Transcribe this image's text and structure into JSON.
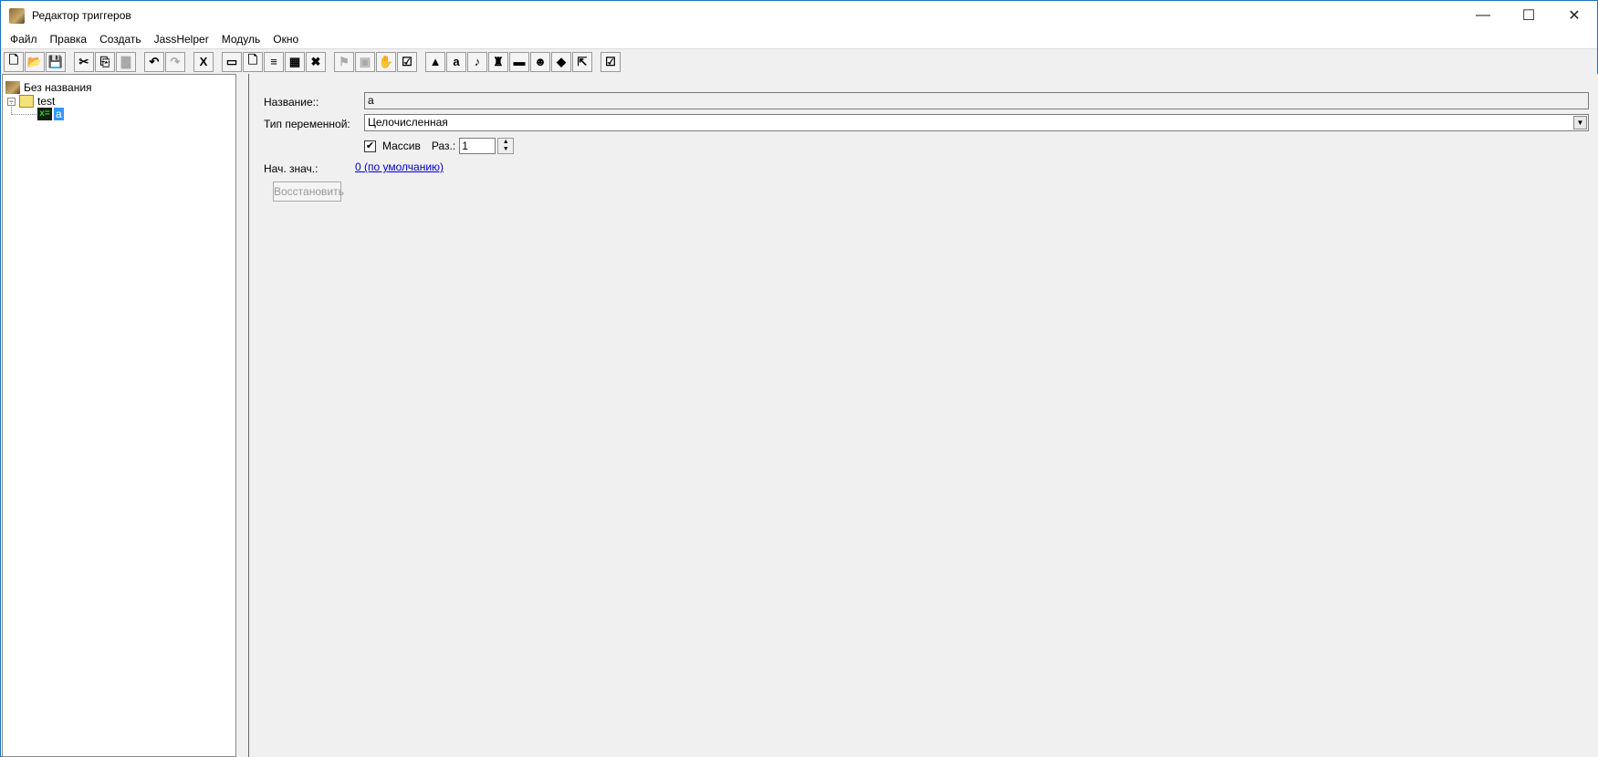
{
  "window": {
    "title": "Редактор триггеров",
    "minimize": "—",
    "maximize": "☐",
    "close": "✕"
  },
  "menu": [
    "Файл",
    "Правка",
    "Создать",
    "JassHelper",
    "Модуль",
    "Окно"
  ],
  "toolbar": [
    {
      "name": "new",
      "g": "🗋"
    },
    {
      "name": "open",
      "g": "📂"
    },
    {
      "name": "save",
      "g": "💾"
    },
    {
      "sep": true
    },
    {
      "name": "cut",
      "g": "✂"
    },
    {
      "name": "copy",
      "g": "⎘"
    },
    {
      "name": "paste",
      "g": "▇",
      "dis": true
    },
    {
      "sep": true
    },
    {
      "name": "undo",
      "g": "↶"
    },
    {
      "name": "redo",
      "g": "↷",
      "dis": true
    },
    {
      "sep": true
    },
    {
      "name": "disable",
      "g": "X"
    },
    {
      "sep": true
    },
    {
      "name": "new-category",
      "g": "▭"
    },
    {
      "name": "new-trigger",
      "g": "🗋"
    },
    {
      "name": "new-comment",
      "g": "≡"
    },
    {
      "name": "new-variable",
      "g": "▦"
    },
    {
      "name": "new-variable-x",
      "g": "✖"
    },
    {
      "sep": true
    },
    {
      "name": "event",
      "g": "⚑",
      "dis": true
    },
    {
      "name": "condition",
      "g": "▣",
      "dis": true
    },
    {
      "name": "action",
      "g": "✋",
      "dis": true
    },
    {
      "name": "checklist",
      "g": "☑"
    },
    {
      "sep": true
    },
    {
      "name": "terrain-editor",
      "g": "▲"
    },
    {
      "name": "trigger-editor",
      "g": "a"
    },
    {
      "name": "sound-editor",
      "g": "♪"
    },
    {
      "name": "object-editor",
      "g": "♜"
    },
    {
      "name": "campaign-editor",
      "g": "▬"
    },
    {
      "name": "ai-editor",
      "g": "☻"
    },
    {
      "name": "import-manager",
      "g": "◆"
    },
    {
      "name": "export",
      "g": "⇱"
    },
    {
      "sep": true
    },
    {
      "name": "test-map",
      "g": "☑"
    }
  ],
  "tree": {
    "root": "Без названия",
    "category": "test",
    "variable": "a"
  },
  "form": {
    "name_label": "Название::",
    "name_value": "a",
    "type_label": "Тип переменной:",
    "type_value": "Целочисленная",
    "array_label": "Массив",
    "array_checked": true,
    "size_label": "Раз.:",
    "size_value": "1",
    "init_label": "Нач. знач.:",
    "init_value": "0 (по умолчанию)",
    "restore_label": "Восстановить"
  }
}
